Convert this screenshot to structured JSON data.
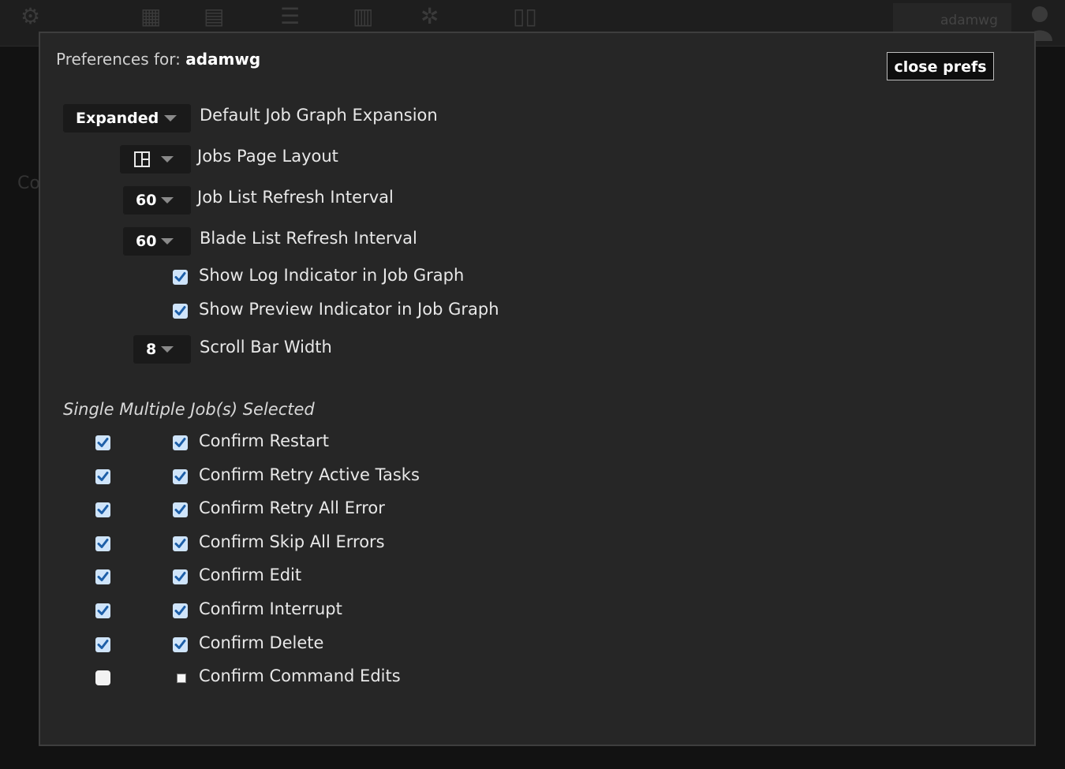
{
  "topbar": {
    "username": "adamwg",
    "icons": [
      "tractor-logo-icon",
      "hierarchy-icon",
      "server-rack-icon",
      "list-search-icon",
      "bar-chart-icon",
      "gear-icon",
      "book-icon",
      "user-silhouette-icon"
    ]
  },
  "background": {
    "hint_text": "Co"
  },
  "prefs": {
    "header_prefix": "Preferences for:",
    "username": "adamwg",
    "close_label": "close prefs",
    "settings": [
      {
        "value": "Expanded",
        "label": "Default Job Graph Expansion"
      },
      {
        "value_icon": "split-layout-icon",
        "label": "Jobs Page Layout"
      },
      {
        "value": "60",
        "label": "Job List Refresh Interval"
      },
      {
        "value": "60",
        "label": "Blade List Refresh Interval"
      }
    ],
    "toggles": [
      {
        "checked": true,
        "label": "Show Log Indicator in Job Graph"
      },
      {
        "checked": true,
        "label": "Show Preview Indicator in Job Graph"
      }
    ],
    "scroll": {
      "value": "8",
      "label": "Scroll Bar Width"
    },
    "section_title": "Single Multiple Job(s) Selected",
    "confirms": [
      {
        "single": true,
        "multiple": true,
        "label": "Confirm Restart"
      },
      {
        "single": true,
        "multiple": true,
        "label": "Confirm Retry Active Tasks"
      },
      {
        "single": true,
        "multiple": true,
        "label": "Confirm Retry All Error"
      },
      {
        "single": true,
        "multiple": true,
        "label": "Confirm Skip All Errors"
      },
      {
        "single": true,
        "multiple": true,
        "label": "Confirm Edit"
      },
      {
        "single": true,
        "multiple": true,
        "label": "Confirm Interrupt"
      },
      {
        "single": true,
        "multiple": true,
        "label": "Confirm Delete"
      },
      {
        "single": false,
        "multiple": false,
        "label": "Confirm Command Edits"
      }
    ]
  },
  "colors": {
    "panel_bg": "#262626",
    "checkbox_fill": "#cfe4fa",
    "check_mark": "#1d5fa8"
  }
}
